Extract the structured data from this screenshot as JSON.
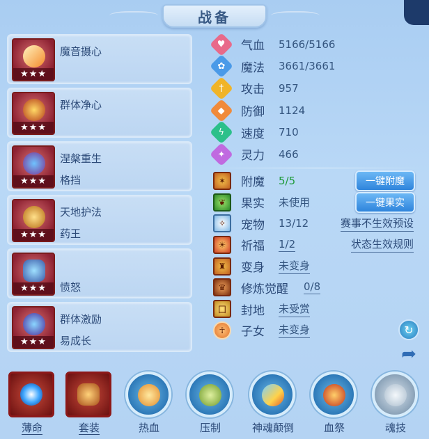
{
  "header": {
    "title": "战备"
  },
  "skills": [
    {
      "line1": "魔音摄心",
      "line2": "",
      "stars": "★★★"
    },
    {
      "line1": "群体净心",
      "line2": "",
      "stars": "★★★"
    },
    {
      "line1": "涅槃重生",
      "line2": "格挡",
      "stars": "★★★"
    },
    {
      "line1": "天地护法",
      "line2": "药王",
      "stars": "★★★"
    },
    {
      "line1": "",
      "line2": "愤怒",
      "stars": "★★★"
    },
    {
      "line1": "群体激励",
      "line2": "易成长",
      "stars": "★★★"
    }
  ],
  "stats": [
    {
      "label": "气血",
      "value": "5166/5166",
      "color": "#e86a8a",
      "icon": "heart-icon",
      "glyph": "♥"
    },
    {
      "label": "魔法",
      "value": "3661/3661",
      "color": "#4a9ae8",
      "icon": "mana-icon",
      "glyph": "✿"
    },
    {
      "label": "攻击",
      "value": "957",
      "color": "#f0b428",
      "icon": "sword-icon",
      "glyph": "†"
    },
    {
      "label": "防御",
      "value": "1124",
      "color": "#f08a3a",
      "icon": "shield-icon",
      "glyph": "◆"
    },
    {
      "label": "速度",
      "value": "710",
      "color": "#2cc08a",
      "icon": "speed-icon",
      "glyph": "ϟ"
    },
    {
      "label": "灵力",
      "value": "466",
      "color": "#c06ae0",
      "icon": "spirit-icon",
      "glyph": "✦"
    }
  ],
  "attrs": [
    {
      "label": "附魔",
      "value": "5/5",
      "icon": "enchant-icon"
    },
    {
      "label": "果实",
      "value": "未使用",
      "icon": "fruit-icon"
    },
    {
      "label": "宠物",
      "value": "13/12",
      "icon": "pet-icon"
    },
    {
      "label": "祈福",
      "value": "1/2",
      "icon": "blessing-icon"
    },
    {
      "label": "变身",
      "value": "未变身",
      "icon": "transform-icon"
    },
    {
      "label": "修炼觉醒",
      "value": "0/8",
      "icon": "cultivation-icon"
    },
    {
      "label": "封地",
      "value": "未受赏",
      "icon": "fief-icon"
    },
    {
      "label": "子女",
      "value": "未变身",
      "icon": "children-icon"
    }
  ],
  "buttons": {
    "enchant": "一键附魔",
    "fruit": "一键果实",
    "preset_link": "赛事不生效预设",
    "rule_link": "状态生效规则"
  },
  "bottom_nav": [
    {
      "label": "薄命",
      "style": "square"
    },
    {
      "label": "套装",
      "style": "square"
    },
    {
      "label": "热血",
      "style": "round"
    },
    {
      "label": "压制",
      "style": "round"
    },
    {
      "label": "神魂颠倒",
      "style": "round"
    },
    {
      "label": "血祭",
      "style": "round"
    },
    {
      "label": "魂技",
      "style": "round"
    }
  ],
  "colors": {
    "accent_green": "#1e9a3a",
    "button_blue": "#2e84dc"
  }
}
